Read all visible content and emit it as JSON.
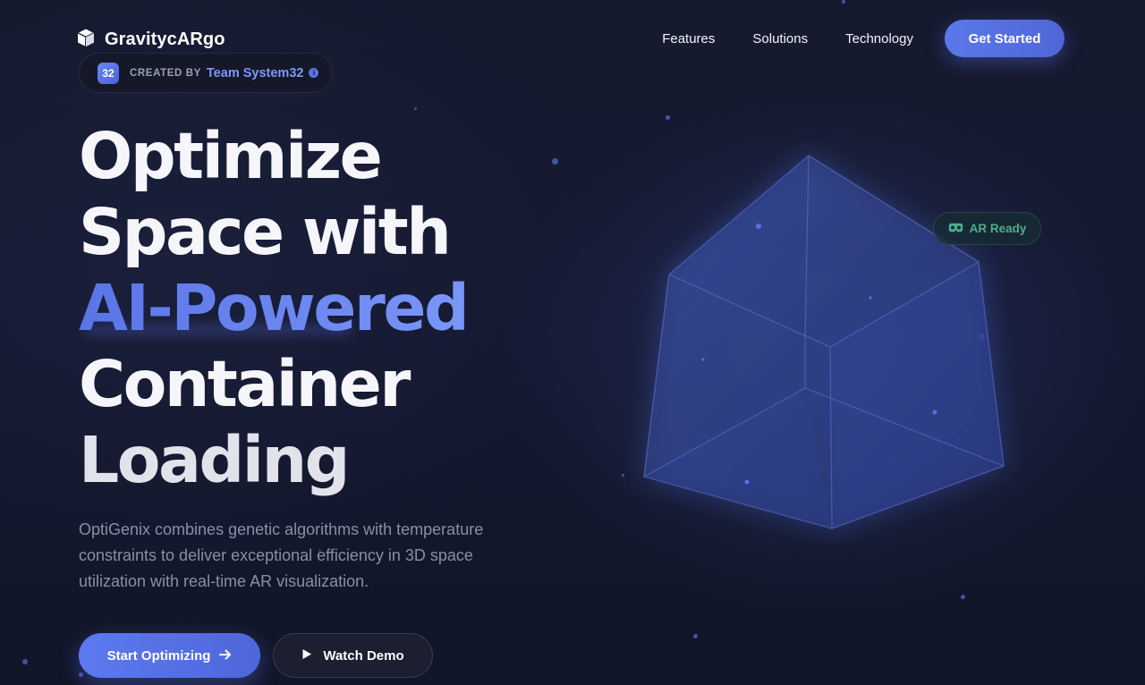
{
  "brand": {
    "name": "GravitycARgo",
    "icon": "cube-icon"
  },
  "nav": {
    "links": [
      "Features",
      "Solutions",
      "Technology"
    ],
    "cta_label": "Get Started"
  },
  "creator": {
    "badge": "32",
    "label": "CREATED BY",
    "name": "Team System32",
    "info_icon": "info-icon"
  },
  "hero": {
    "line1": "Optimize",
    "line2": "Space with",
    "line3": "AI-Powered",
    "line4": "Container",
    "line5": "Loading",
    "description": "OptiGenix combines genetic algorithms with temperature constraints to deliver exceptional efficiency in 3D space utilization with real-time AR visualization.",
    "primary_button": "Start Optimizing",
    "primary_icon": "arrow-right-icon",
    "secondary_button": "Watch Demo",
    "secondary_icon": "play-icon"
  },
  "visual": {
    "ar_badge": "AR Ready",
    "ar_icon": "vr-headset-icon"
  },
  "colors": {
    "background": "#14182b",
    "accent": "#6783f0",
    "ar_green": "#4fae8a"
  }
}
